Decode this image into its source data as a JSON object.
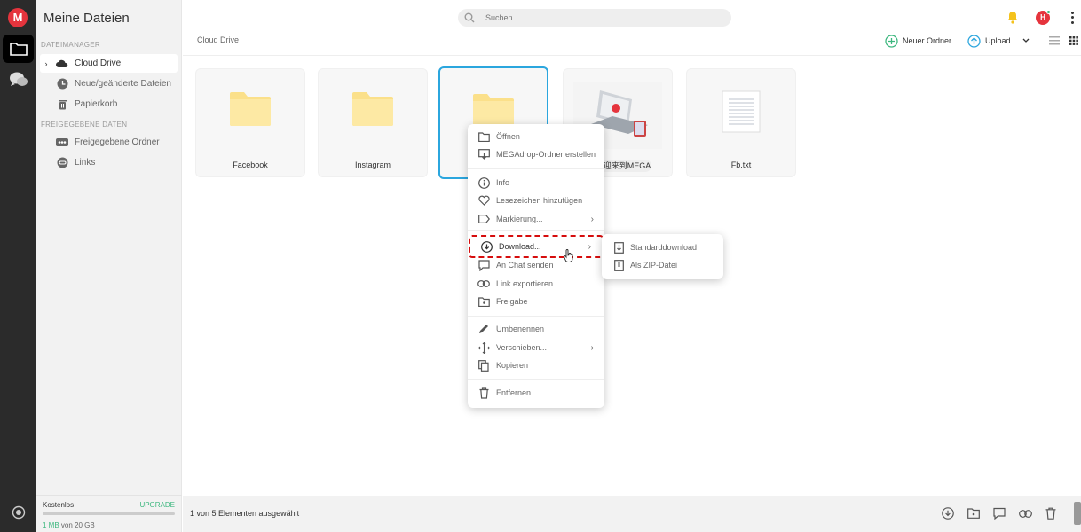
{
  "app": {
    "logo_letter": "M"
  },
  "sidebar": {
    "title": "Meine Dateien",
    "section_file_manager": "DATEIMANAGER",
    "section_shared": "FREIGEGEBENE DATEN",
    "items": [
      {
        "label": "Cloud Drive",
        "icon": "cloud-icon"
      },
      {
        "label": "Neue/geänderte Dateien",
        "icon": "clock-icon"
      },
      {
        "label": "Papierkorb",
        "icon": "trash-icon"
      },
      {
        "label": "Freigegebene Ordner",
        "icon": "shared-folder-icon"
      },
      {
        "label": "Links",
        "icon": "link-icon"
      }
    ],
    "storage": {
      "plan": "Kostenlos",
      "upgrade": "UPGRADE",
      "used": "1 MB",
      "total": " von 20 GB",
      "used_fraction": 5e-05
    }
  },
  "topbar": {
    "search_placeholder": "Suchen",
    "avatar_letter": "H"
  },
  "header": {
    "breadcrumb": "Cloud Drive",
    "new_folder": "Neuer Ordner",
    "upload": "Upload..."
  },
  "tiles": [
    {
      "name": "Facebook",
      "type": "folder"
    },
    {
      "name": "Instagram",
      "type": "folder"
    },
    {
      "name": "",
      "type": "folder",
      "selected": true
    },
    {
      "name": "欢迎来到MEGA",
      "type": "image"
    },
    {
      "name": "Fb.txt",
      "type": "text"
    }
  ],
  "context_menu": {
    "items": [
      {
        "label": "Öffnen",
        "icon": "folder-open-icon"
      },
      {
        "label": "MEGAdrop-Ordner erstellen",
        "icon": "megadrop-icon"
      },
      {
        "label": "Info",
        "icon": "info-icon"
      },
      {
        "label": "Lesezeichen hinzufügen",
        "icon": "heart-icon"
      },
      {
        "label": "Markierung...",
        "icon": "tag-icon",
        "submenu": true
      },
      {
        "label": "Download...",
        "icon": "download-icon",
        "submenu": true
      },
      {
        "label": "An Chat senden",
        "icon": "send-to-chat-icon"
      },
      {
        "label": "Link exportieren",
        "icon": "link-icon"
      },
      {
        "label": "Freigabe",
        "icon": "share-folder-icon"
      },
      {
        "label": "Umbenennen",
        "icon": "pencil-icon"
      },
      {
        "label": "Verschieben...",
        "icon": "move-icon",
        "submenu": true
      },
      {
        "label": "Kopieren",
        "icon": "copy-icon"
      },
      {
        "label": "Entfernen",
        "icon": "trash-icon"
      }
    ],
    "submenu_arrow": "›"
  },
  "download_submenu": {
    "items": [
      {
        "label": "Standarddownload",
        "icon": "download-file-icon"
      },
      {
        "label": "Als ZIP-Datei",
        "icon": "zip-file-icon"
      }
    ]
  },
  "footer": {
    "status": "1 von 5 Elementen ausgewählt"
  },
  "colors": {
    "brand_red": "#e5343d",
    "accent_green": "#3cb77e",
    "selection_blue": "#2ba6de",
    "highlight_red": "#d60d0d",
    "folder_yellow": "#fbe08a"
  }
}
